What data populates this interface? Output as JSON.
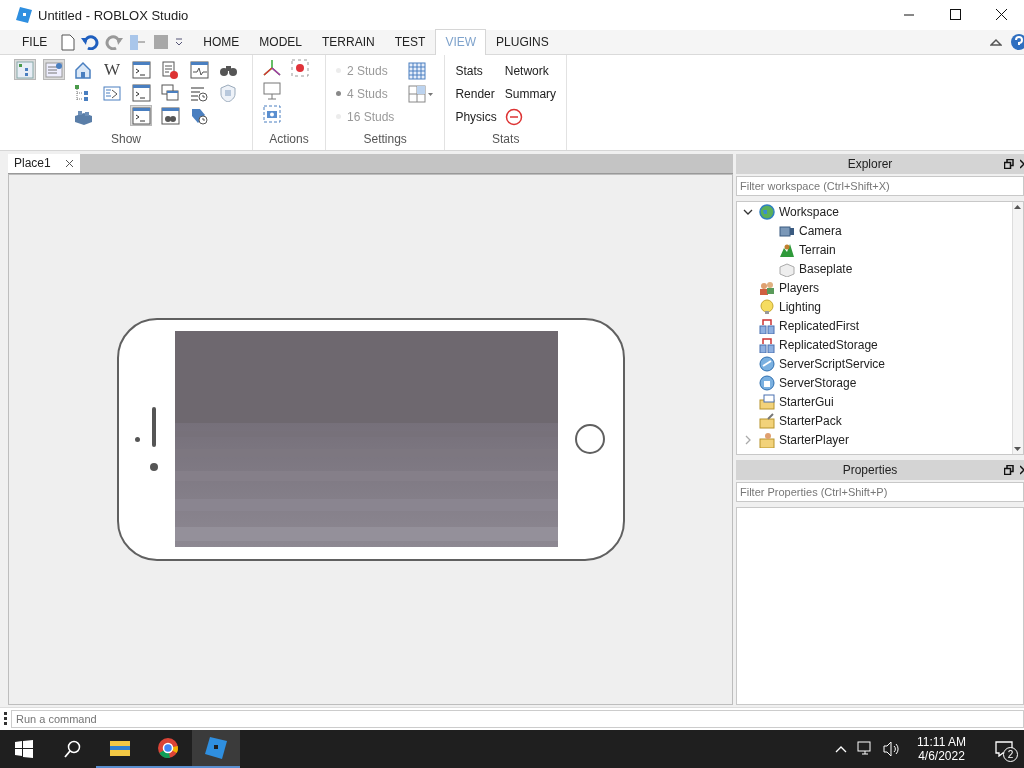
{
  "window": {
    "title": "Untitled - ROBLOX Studio"
  },
  "menu": {
    "file": "FILE",
    "tabs": [
      {
        "label": "HOME",
        "selected": false
      },
      {
        "label": "MODEL",
        "selected": false
      },
      {
        "label": "TERRAIN",
        "selected": false
      },
      {
        "label": "TEST",
        "selected": false
      },
      {
        "label": "VIEW",
        "selected": true
      },
      {
        "label": "PLUGINS",
        "selected": false
      }
    ]
  },
  "ribbon": {
    "show": {
      "title": "Show",
      "rows": [
        [
          {
            "kind": "tree-panel",
            "on": true
          },
          {
            "kind": "list-panel",
            "on": true
          },
          {
            "kind": "house",
            "on": false
          },
          {
            "kind": "letter",
            "glyph": "W",
            "on": false
          },
          {
            "kind": "terminal",
            "on": false
          },
          {
            "kind": "script-stop",
            "on": false
          },
          {
            "kind": "monitor",
            "on": false
          },
          {
            "kind": "binoculars",
            "on": false
          }
        ],
        [
          {
            "kind": "hierarchy",
            "on": false
          },
          {
            "kind": "script-play",
            "on": false
          },
          {
            "kind": "terminal",
            "on": false
          },
          {
            "kind": "windows",
            "on": false
          },
          {
            "kind": "list-clock",
            "on": false
          },
          {
            "kind": "shield",
            "on": false
          }
        ],
        [
          {
            "kind": "bricks",
            "on": false
          },
          {
            "kind": "terminal",
            "on": true
          },
          {
            "kind": "window-find",
            "on": false
          },
          {
            "kind": "tag-clock",
            "on": false
          }
        ]
      ]
    },
    "actions": {
      "title": "Actions"
    },
    "settings": {
      "title": "Settings",
      "options": [
        {
          "label": "2 Studs",
          "selected": false
        },
        {
          "label": "4 Studs",
          "selected": true
        },
        {
          "label": "16 Studs",
          "selected": false
        }
      ]
    },
    "stats": {
      "title": "Stats",
      "buttons": [
        {
          "label": "Stats",
          "kind": "text"
        },
        {
          "label": "Network",
          "kind": "text"
        },
        {
          "label": "Render",
          "kind": "text"
        },
        {
          "label": "Summary",
          "kind": "text"
        },
        {
          "label": "Physics",
          "kind": "text"
        },
        {
          "kind": "clear"
        }
      ]
    }
  },
  "document_tabs": [
    {
      "label": "Place1",
      "selected": true
    }
  ],
  "explorer": {
    "title": "Explorer",
    "filter": {
      "placeholder": "Filter workspace (Ctrl+Shift+X)"
    },
    "items": [
      {
        "name": "Workspace",
        "kind": "globe",
        "expanded": true,
        "children": [
          {
            "name": "Camera",
            "kind": "camera"
          },
          {
            "name": "Terrain",
            "kind": "terrain"
          },
          {
            "name": "Baseplate",
            "kind": "brick"
          }
        ]
      },
      {
        "name": "Players",
        "kind": "people"
      },
      {
        "name": "Lighting",
        "kind": "bulb"
      },
      {
        "name": "ReplicatedFirst",
        "kind": "replicated"
      },
      {
        "name": "ReplicatedStorage",
        "kind": "replicated"
      },
      {
        "name": "ServerScriptService",
        "kind": "server-script"
      },
      {
        "name": "ServerStorage",
        "kind": "server-storage"
      },
      {
        "name": "StarterGui",
        "kind": "folder-gui"
      },
      {
        "name": "StarterPack",
        "kind": "folder-pack"
      },
      {
        "name": "StarterPlayer",
        "kind": "folder-player",
        "expanded": false
      }
    ]
  },
  "properties": {
    "title": "Properties",
    "filter": {
      "placeholder": "Filter Properties (Ctrl+Shift+P)"
    }
  },
  "command_bar": {
    "placeholder": "Run a command"
  },
  "taskbar": {
    "apps": [
      {
        "kind": "folder",
        "active": false
      },
      {
        "kind": "browser",
        "active": false
      },
      {
        "kind": "studio",
        "active": true
      }
    ],
    "time": "11:11 AM",
    "date": "4/6/2022",
    "notifications": "2"
  }
}
